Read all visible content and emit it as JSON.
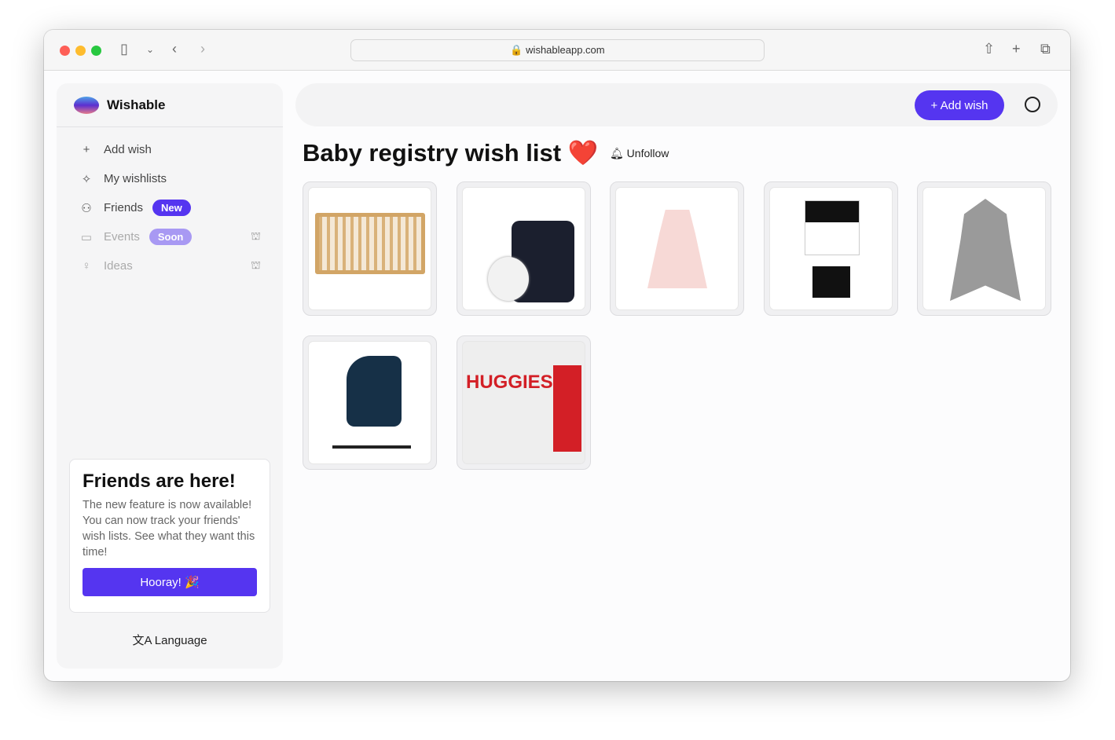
{
  "browser": {
    "url": "wishableapp.com"
  },
  "sidebar": {
    "brand": "Wishable",
    "items": [
      {
        "label": "Add wish",
        "icon": "plus-icon"
      },
      {
        "label": "My wishlists",
        "icon": "sparkles-icon"
      },
      {
        "label": "Friends",
        "icon": "users-icon",
        "badge": "New"
      },
      {
        "label": "Events",
        "icon": "calendar-icon",
        "badge": "Soon",
        "disabled": true
      },
      {
        "label": "Ideas",
        "icon": "lightbulb-icon",
        "disabled": true
      }
    ],
    "promo": {
      "title": "Friends are here!",
      "body": "The new feature is now available! You can now track your friends' wish lists. See what they want this time!",
      "button": "Hooray! 🎉"
    },
    "language": "Language"
  },
  "header": {
    "add_wish": "+ Add wish"
  },
  "main": {
    "title": "Baby registry wish list ❤️",
    "unfollow": "Unfollow",
    "items": [
      {
        "product": "crib"
      },
      {
        "product": "baby monitor"
      },
      {
        "product": "pink dress"
      },
      {
        "product": "shirt and shorts set"
      },
      {
        "product": "elephant lovey blanket"
      },
      {
        "product": "stroller"
      },
      {
        "product": "Huggies wipes"
      }
    ]
  },
  "colors": {
    "accent": "#5535f0",
    "soon": "#a899f3"
  }
}
